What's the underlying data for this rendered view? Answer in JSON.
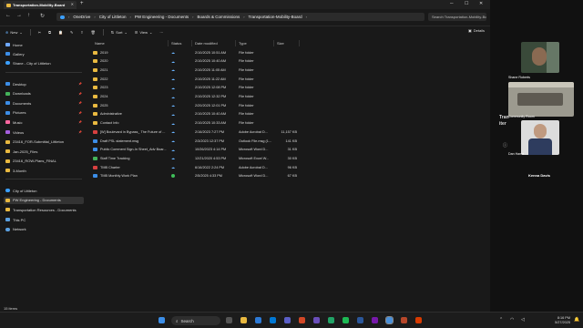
{
  "window": {
    "tab_title": "Transportation-Mobility-Board",
    "tab_close": "✕",
    "tab_add": "+"
  },
  "address": {
    "crumbs": [
      "OneDrive",
      "City of Littleton",
      "PW Engineering - Documents",
      "Boards & Commissions",
      "Transportation-Mobility-Board"
    ],
    "search_placeholder": "Search Transportation-Mobility-Board"
  },
  "toolbar": {
    "new_label": "New",
    "sort_label": "Sort",
    "view_label": "View",
    "more_label": "···",
    "details_label": "Details"
  },
  "sidebar": {
    "quick": [
      {
        "label": "Home",
        "icon": "home-icon"
      },
      {
        "label": "Gallery",
        "icon": "gallery-icon"
      },
      {
        "label": "Shane - City of Littleton",
        "icon": "cloud-icon"
      }
    ],
    "pinned": [
      {
        "label": "Desktop",
        "icon": "desktop-icon"
      },
      {
        "label": "Downloads",
        "icon": "download-icon"
      },
      {
        "label": "Documents",
        "icon": "documents-icon"
      },
      {
        "label": "Pictures",
        "icon": "pictures-icon"
      },
      {
        "label": "Music",
        "icon": "music-icon"
      },
      {
        "label": "Videos",
        "icon": "videos-icon"
      },
      {
        "label": "23416_FOR-Submittal_Littleton",
        "icon": "folder-icon"
      },
      {
        "label": "Jan-2025_Files",
        "icon": "folder-icon"
      },
      {
        "label": "23416_ROW-Plans_FINAL",
        "icon": "folder-icon"
      },
      {
        "label": "3-Month",
        "icon": "folder-icon"
      }
    ],
    "tree": [
      {
        "label": "City of Littleton",
        "icon": "cloud-icon"
      },
      {
        "label": "PW Engineering - Documents",
        "icon": "folder-icon",
        "selected": true
      },
      {
        "label": "Transportation Resources - Documents",
        "icon": "folder-icon"
      },
      {
        "label": "This PC",
        "icon": "pc-icon"
      },
      {
        "label": "Network",
        "icon": "network-icon"
      }
    ]
  },
  "columns": {
    "name": "Name",
    "status": "Status",
    "date": "Date modified",
    "type": "Type",
    "size": "Size"
  },
  "files": [
    {
      "name": "2019",
      "status": "cloud",
      "date": "2/10/2025 10:51 AM",
      "type": "File folder",
      "size": "",
      "kind": "folder"
    },
    {
      "name": "2020",
      "status": "cloud",
      "date": "2/10/2025 10:40 AM",
      "type": "File folder",
      "size": "",
      "kind": "folder"
    },
    {
      "name": "2021",
      "status": "cloud",
      "date": "2/10/2025 11:05 AM",
      "type": "File folder",
      "size": "",
      "kind": "folder"
    },
    {
      "name": "2022",
      "status": "cloud",
      "date": "2/10/2025 11:22 AM",
      "type": "File folder",
      "size": "",
      "kind": "folder"
    },
    {
      "name": "2023",
      "status": "cloud",
      "date": "2/10/2025 12:08 PM",
      "type": "File folder",
      "size": "",
      "kind": "folder"
    },
    {
      "name": "2024",
      "status": "cloud",
      "date": "2/10/2025 12:32 PM",
      "type": "File folder",
      "size": "",
      "kind": "folder"
    },
    {
      "name": "2025",
      "status": "cloud",
      "date": "2/20/2025 12:01 PM",
      "type": "File folder",
      "size": "",
      "kind": "folder"
    },
    {
      "name": "Administrative",
      "status": "cloud",
      "date": "2/10/2025 10:40 AM",
      "type": "File folder",
      "size": "",
      "kind": "folder"
    },
    {
      "name": "Contact Info",
      "status": "cloud",
      "date": "2/10/2025 10:33 AM",
      "type": "File folder",
      "size": "",
      "kind": "folder"
    },
    {
      "name": "[W] Boulevard in Bypass_ The Future of ...",
      "status": "cloud",
      "date": "2/16/2023 7:27 PM",
      "type": "Adobe Acrobat D...",
      "size": "11,157 KB",
      "kind": "pdf"
    },
    {
      "name": "Draft PSL statement.msg",
      "status": "cloud",
      "date": "2/3/2023 12:37 PM",
      "type": "Outlook File.msg (1...",
      "size": "141 KB",
      "kind": "msg"
    },
    {
      "name": "Public Comment Sign-In Sheet_Adv Boar...",
      "status": "cloud",
      "date": "10/26/2023 4:14 PM",
      "type": "Microsoft Word D...",
      "size": "31 KB",
      "kind": "doc"
    },
    {
      "name": "Staff Time Tracking",
      "status": "cloud",
      "date": "12/21/2020 4:53 PM",
      "type": "Microsoft Excel W...",
      "size": "30 KB",
      "kind": "xls"
    },
    {
      "name": "TMB Charter",
      "status": "cloud",
      "date": "6/16/2022 2:24 PM",
      "type": "Adobe Acrobat D...",
      "size": "96 KB",
      "kind": "pdf"
    },
    {
      "name": "TMB Monthly Work Plan",
      "status": "ok",
      "date": "2/5/2025 4:33 PM",
      "type": "Microsoft Word D...",
      "size": "67 KB",
      "kind": "doc"
    }
  ],
  "statusbar": {
    "count": "15 items"
  },
  "teams": {
    "participants": [
      "Shane Roberts",
      "Community Room",
      "Dan Hame"
    ],
    "side_text_1": "Tran",
    "side_text_2": "iter",
    "bottom_name": "Kenna Davis"
  },
  "taskbar": {
    "search_label": "Search",
    "time": "8:16 PM",
    "date": "5/27/2025"
  },
  "colors": {
    "accent": "#3c8ee8",
    "folder": "#e9b940",
    "window": "#191919"
  }
}
